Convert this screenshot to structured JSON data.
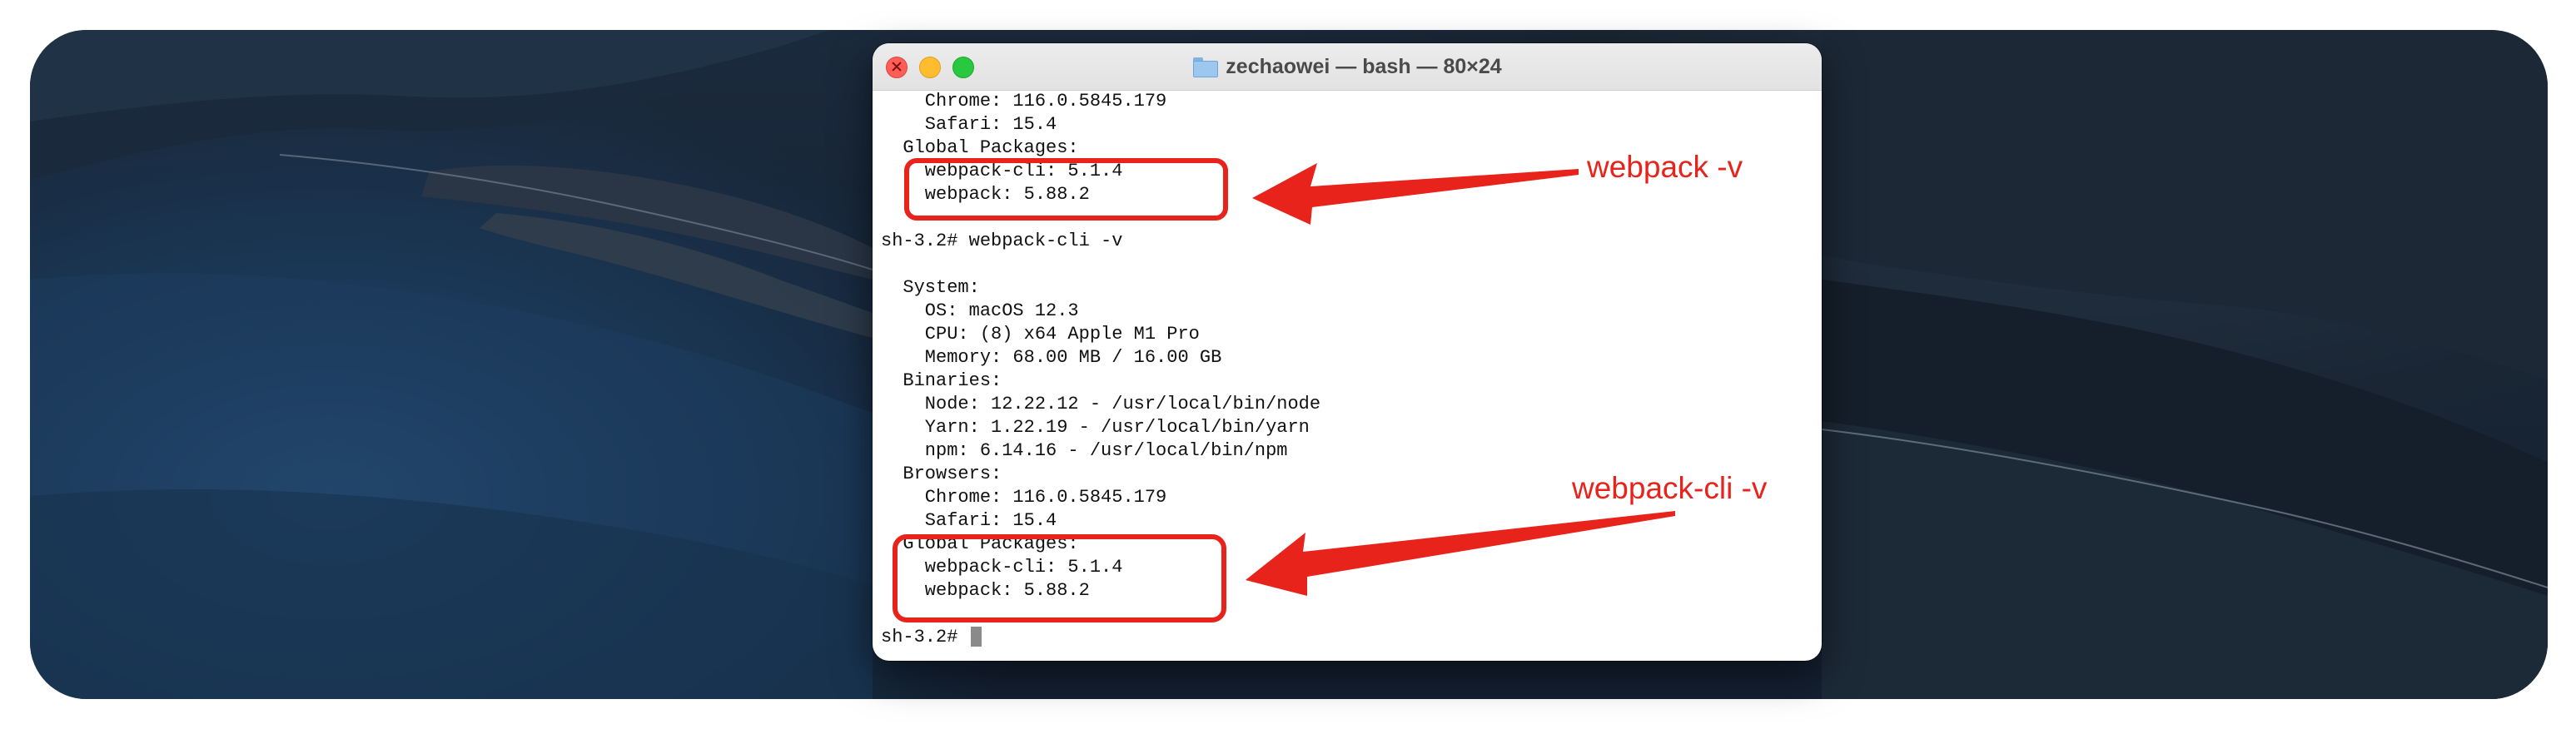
{
  "window": {
    "title": "zechaowei — bash — 80×24",
    "folder_icon": "folder-icon"
  },
  "terminal": {
    "lines": [
      "    Chrome: 116.0.5845.179",
      "    Safari: 15.4",
      "  Global Packages:",
      "    webpack-cli: 5.1.4",
      "    webpack: 5.88.2",
      "",
      "sh-3.2# webpack-cli -v",
      "",
      "  System:",
      "    OS: macOS 12.3",
      "    CPU: (8) x64 Apple M1 Pro",
      "    Memory: 68.00 MB / 16.00 GB",
      "  Binaries:",
      "    Node: 12.22.12 - /usr/local/bin/node",
      "    Yarn: 1.22.19 - /usr/local/bin/yarn",
      "    npm: 6.14.16 - /usr/local/bin/npm",
      "  Browsers:",
      "    Chrome: 116.0.5845.179",
      "    Safari: 15.4",
      "  Global Packages:",
      "    webpack-cli: 5.1.4",
      "    webpack: 5.88.2",
      "",
      "sh-3.2# "
    ]
  },
  "annotations": {
    "first": "webpack -v",
    "second": "webpack-cli -v"
  },
  "colors": {
    "annotation": "#e8231b",
    "terminal_bg": "#ffffff",
    "close": "#ff5f57",
    "minimize": "#febc2e",
    "maximize": "#28c840"
  }
}
